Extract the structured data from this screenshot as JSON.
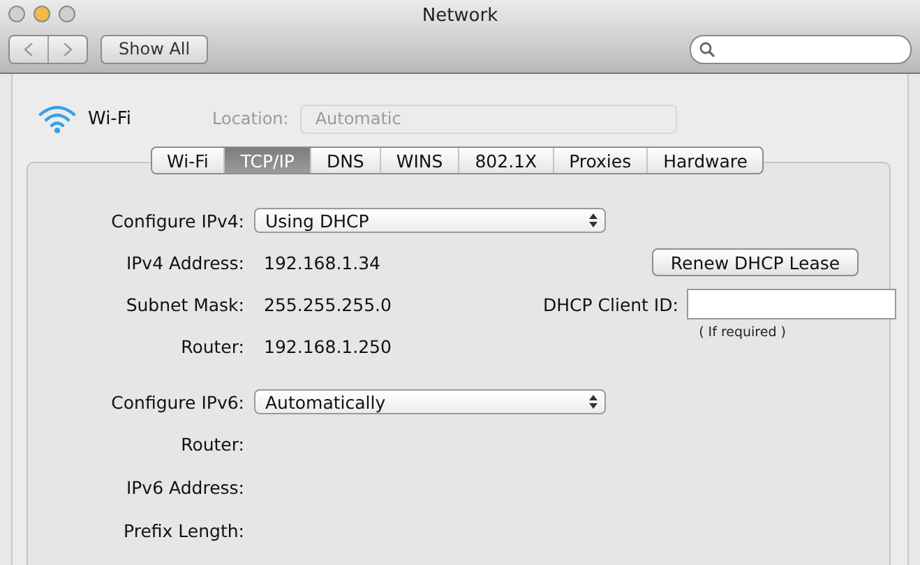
{
  "window": {
    "title": "Network"
  },
  "toolbar": {
    "show_all": "Show All"
  },
  "service": {
    "name": "Wi-Fi",
    "location_label": "Location:",
    "location_value": "Automatic"
  },
  "tabs": [
    {
      "label": "Wi-Fi",
      "selected": false
    },
    {
      "label": "TCP/IP",
      "selected": true
    },
    {
      "label": "DNS",
      "selected": false
    },
    {
      "label": "WINS",
      "selected": false
    },
    {
      "label": "802.1X",
      "selected": false
    },
    {
      "label": "Proxies",
      "selected": false
    },
    {
      "label": "Hardware",
      "selected": false
    }
  ],
  "ipv4": {
    "configure_label": "Configure IPv4:",
    "configure_value": "Using DHCP",
    "rows": [
      {
        "label": "IPv4 Address:",
        "value": "192.168.1.34"
      },
      {
        "label": "Subnet Mask:",
        "value": "255.255.255.0"
      },
      {
        "label": "Router:",
        "value": "192.168.1.250"
      }
    ]
  },
  "dhcp": {
    "renew_button": "Renew DHCP Lease",
    "client_id_label": "DHCP Client ID:",
    "client_id_hint": "( If required )"
  },
  "ipv6": {
    "configure_label": "Configure IPv6:",
    "configure_value": "Automatically",
    "rows": [
      {
        "label": "Router:"
      },
      {
        "label": "IPv6 Address:"
      },
      {
        "label": "Prefix Length:"
      }
    ]
  }
}
